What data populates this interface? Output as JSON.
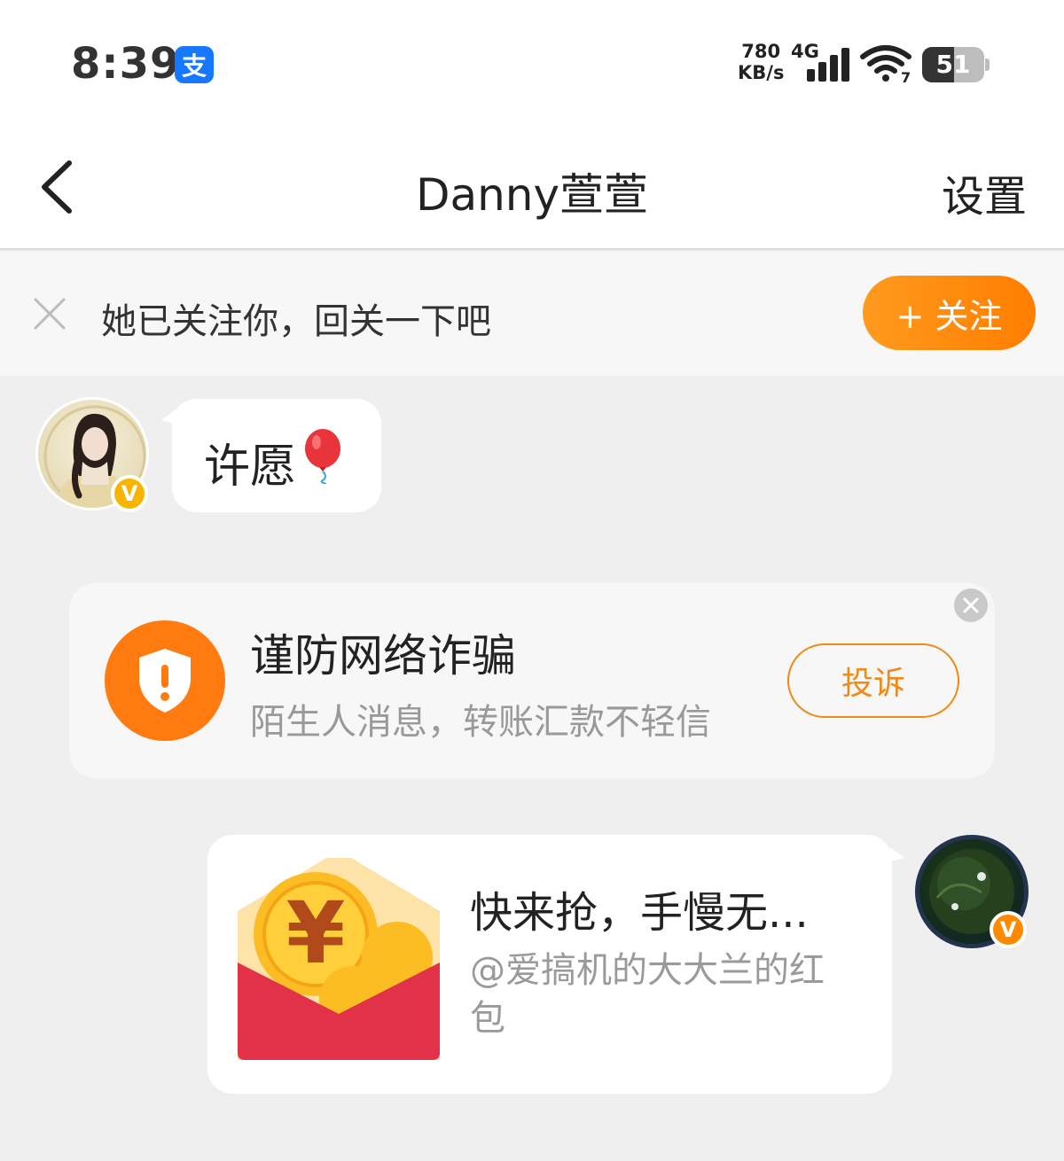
{
  "status_bar": {
    "time": "8:39",
    "app_icon": "alipay-icon",
    "app_icon_glyph": "支",
    "net_speed_value": "780",
    "net_speed_unit": "KB/s",
    "network_type": "4G",
    "wifi_label": "7",
    "battery_level": "51",
    "battery_fraction": 0.51
  },
  "header": {
    "title": "Danny萱萱",
    "settings_label": "设置"
  },
  "follow_banner": {
    "text": "她已关注你，回关一下吧",
    "button_label": "+ 关注"
  },
  "messages": [
    {
      "side": "left",
      "text": "许愿",
      "emoji": "balloon-icon"
    }
  ],
  "fraud_card": {
    "title": "谨防网络诈骗",
    "subtitle": "陌生人消息，转账汇款不轻信",
    "button_label": "投诉"
  },
  "red_packet": {
    "title": "快来抢，手慢无...",
    "subtitle": "@爱搞机的大大兰的红包"
  },
  "colors": {
    "accent_orange": "#ff8a00",
    "badge_yellow": "#f7b500",
    "background": "#efefef"
  }
}
